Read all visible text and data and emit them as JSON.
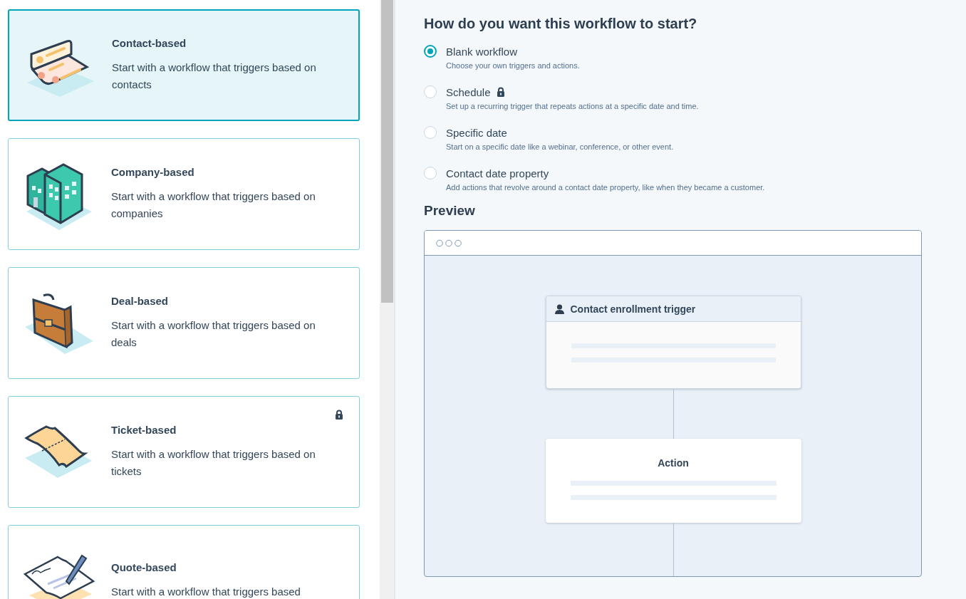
{
  "object_cards": [
    {
      "kind": "contact",
      "title": "Contact-based",
      "description": "Start with a workflow that triggers based on contacts",
      "selected": true,
      "locked": false
    },
    {
      "kind": "company",
      "title": "Company-based",
      "description": "Start with a workflow that triggers based on companies",
      "selected": false,
      "locked": false
    },
    {
      "kind": "deal",
      "title": "Deal-based",
      "description": "Start with a workflow that triggers based on deals",
      "selected": false,
      "locked": false
    },
    {
      "kind": "ticket",
      "title": "Ticket-based",
      "description": "Start with a workflow that triggers based on tickets",
      "selected": false,
      "locked": true
    },
    {
      "kind": "quote",
      "title": "Quote-based",
      "description": "Start with a workflow that triggers based",
      "selected": false,
      "locked": false
    }
  ],
  "start_section": {
    "heading": "How do you want this workflow to start?",
    "options": [
      {
        "label": "Blank workflow",
        "description": "Choose your own triggers and actions.",
        "selected": true,
        "locked": false
      },
      {
        "label": "Schedule",
        "description": "Set up a recurring trigger that repeats actions at a specific date and time.",
        "selected": false,
        "locked": true
      },
      {
        "label": "Specific date",
        "description": "Start on a specific date like a webinar, conference, or other event.",
        "selected": false,
        "locked": false
      },
      {
        "label": "Contact date property",
        "description": "Add actions that revolve around a contact date property, like when they became a customer.",
        "selected": false,
        "locked": false
      }
    ]
  },
  "preview": {
    "heading": "Preview",
    "trigger_card": {
      "title": "Contact enrollment trigger"
    },
    "action_card": {
      "title": "Action"
    }
  }
}
